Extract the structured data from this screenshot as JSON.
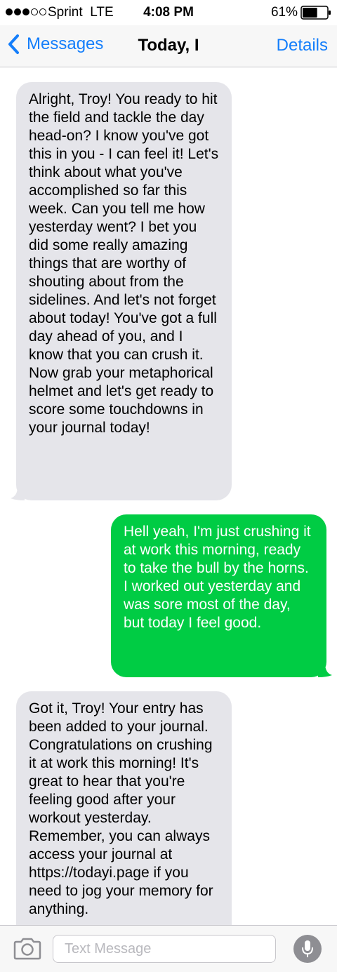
{
  "status_bar": {
    "carrier": "Sprint",
    "network": "LTE",
    "time": "4:08 PM",
    "battery": "61%",
    "battery_level": 0.61,
    "signal_bars_filled": 3,
    "signal_bars_total": 5
  },
  "nav": {
    "back_label": "Messages",
    "title": "Today, I",
    "details_label": "Details"
  },
  "colors": {
    "accent": "#147efb",
    "incoming_bubble": "#e5e5ea",
    "outgoing_bubble": "#00cc44"
  },
  "messages": [
    {
      "direction": "incoming",
      "text": "Alright, Troy! You ready to hit the field and tackle the day head-on? I know you've got this in you - I can feel it! Let's think about what you've accomplished so far this week. Can you tell me how yesterday went? I bet you did some really amazing things that are worthy of shouting about from the sidelines. And let's not forget about today! You've got a full day ahead of you, and I know that you can crush it. Now grab your metaphorical helmet and let's get ready to score some touchdowns in your journal today!"
    },
    {
      "direction": "outgoing",
      "text": "Hell yeah, I'm just crushing it at work this morning, ready to take the bull by the horns. I worked out yesterday and was sore most of the day, but today I feel good."
    },
    {
      "direction": "incoming",
      "text": "Got it, Troy! Your entry has been added to your journal. Congratulations on crushing it at work this morning! It's great to hear that you're feeling good after your workout yesterday. Remember, you can always access your journal at https://todayi.page if you need to jog your memory for anything."
    }
  ],
  "input": {
    "placeholder": "Text Message",
    "value": ""
  },
  "icons": {
    "back": "chevron-left-icon",
    "camera": "camera-icon",
    "mic": "microphone-icon"
  }
}
